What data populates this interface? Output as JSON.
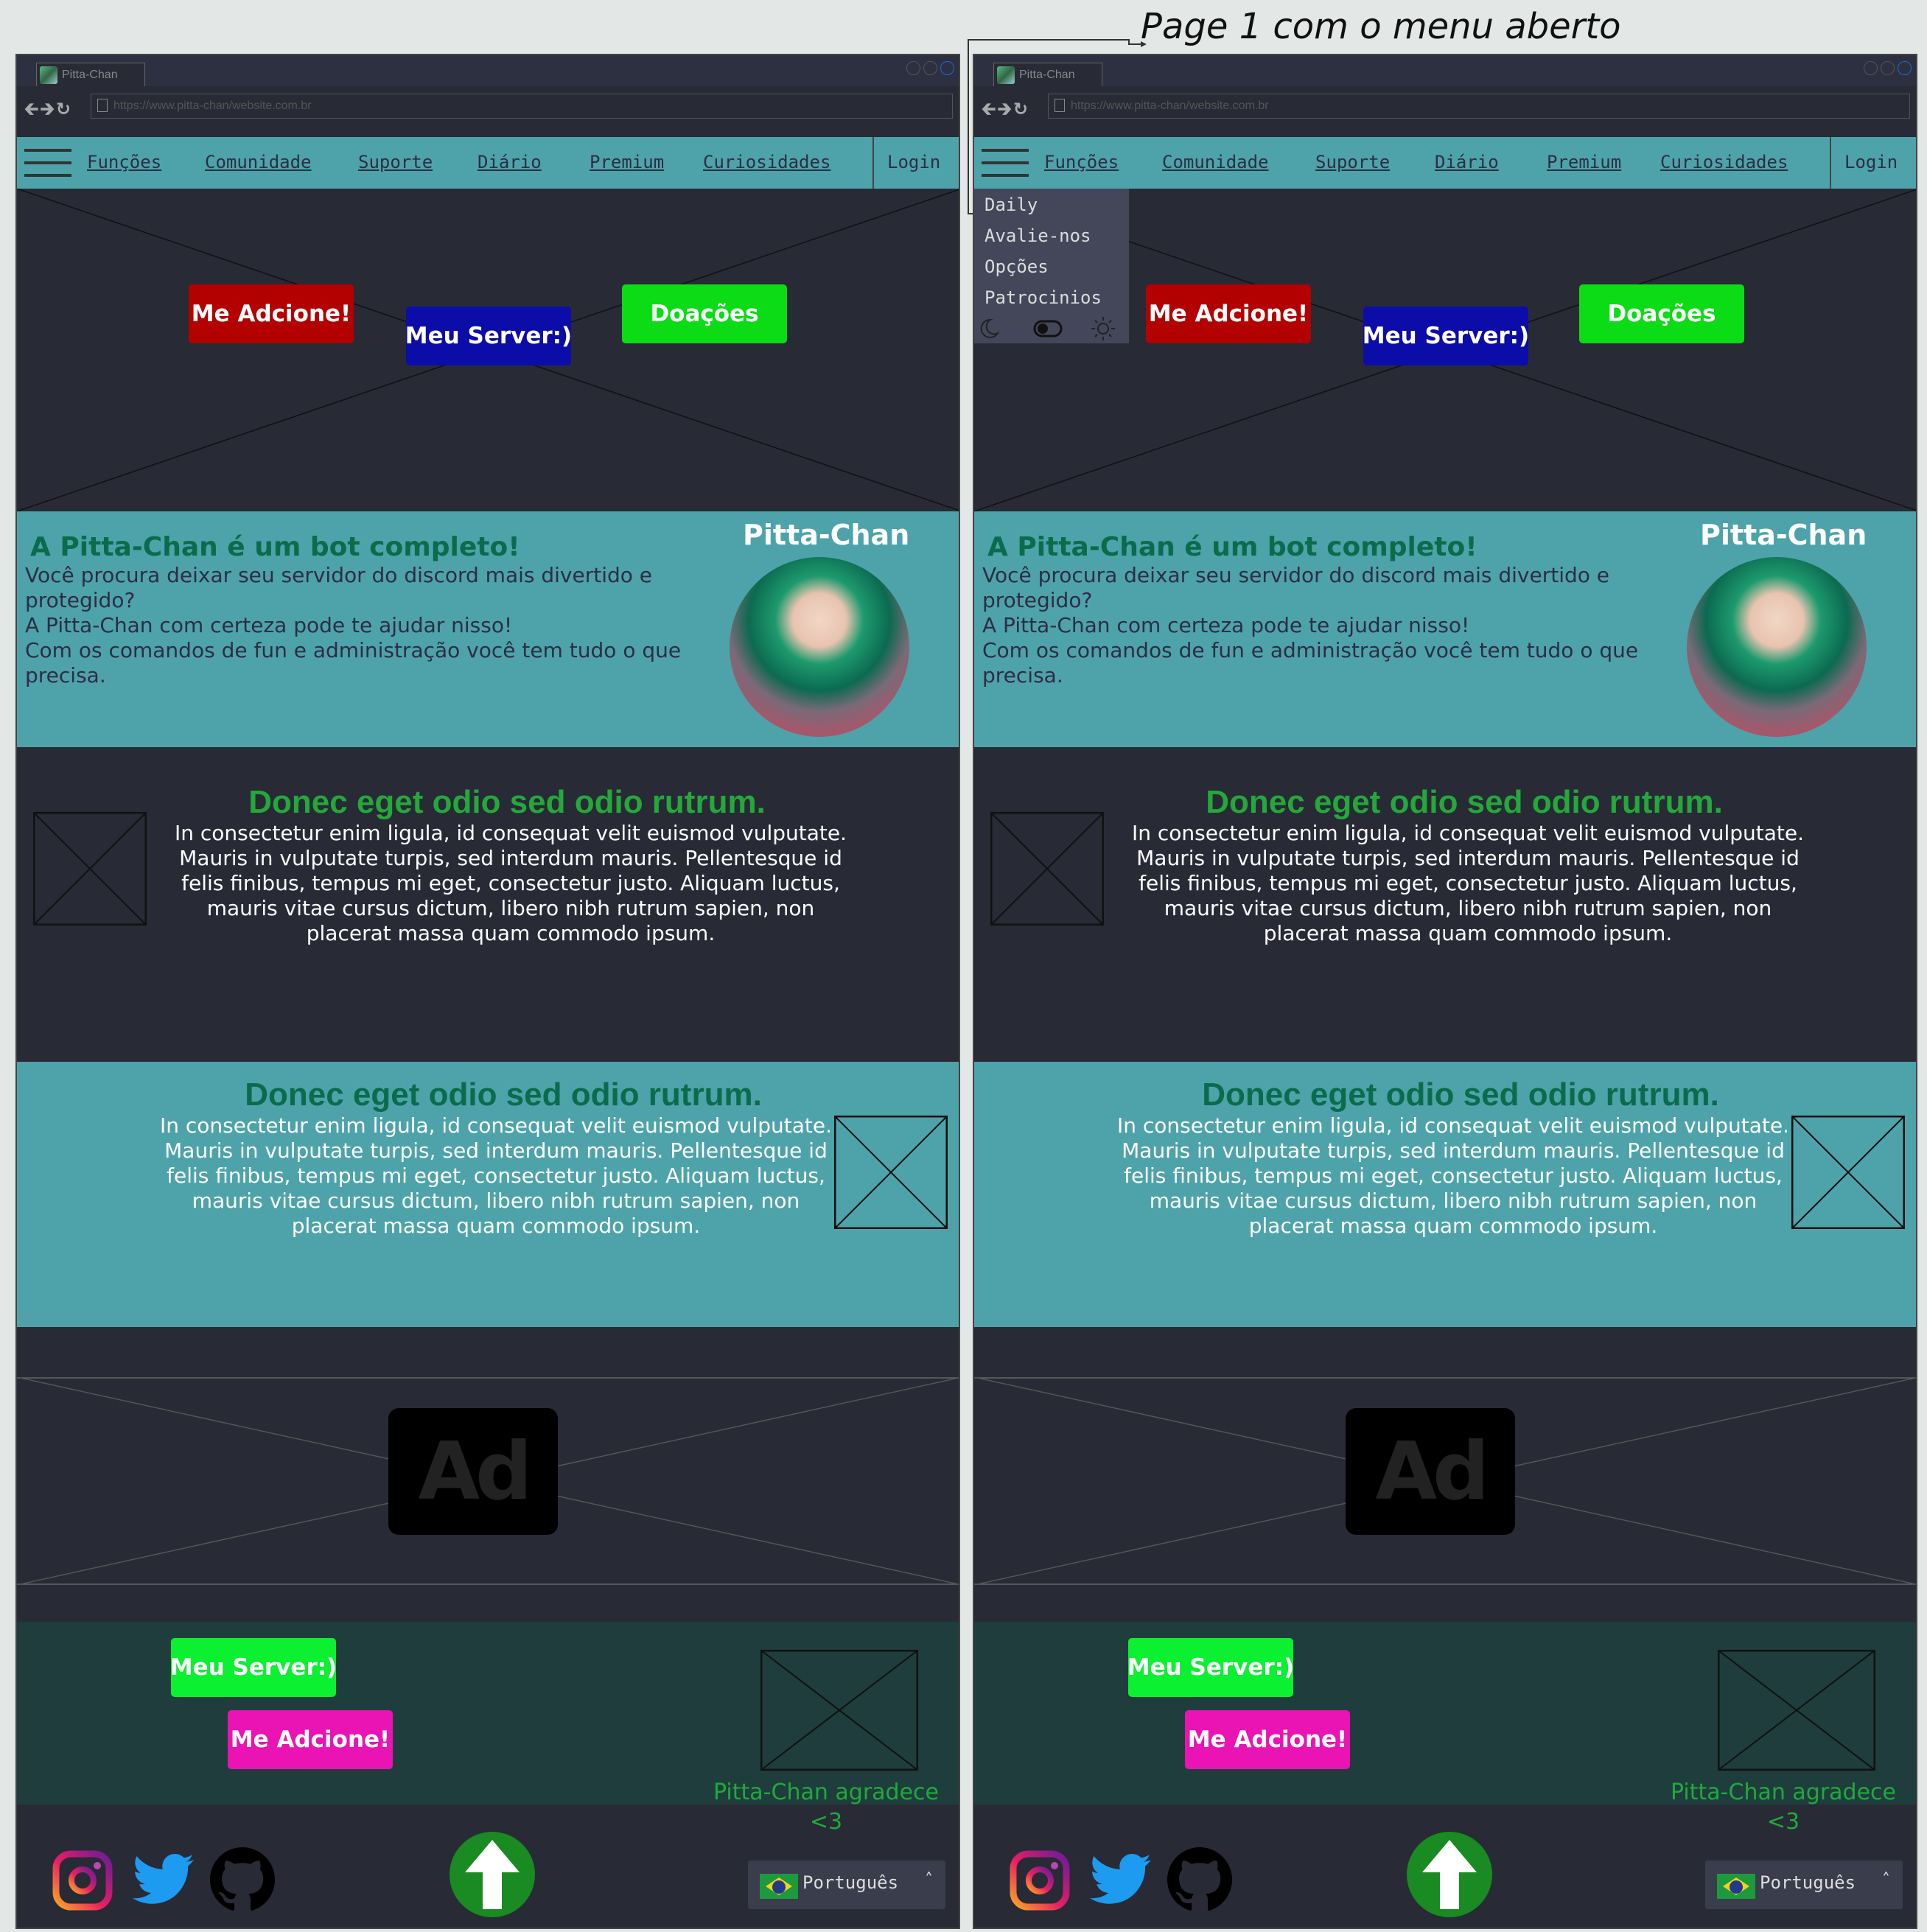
{
  "annotation": {
    "text": "Page 1 com o menu aberto"
  },
  "browser": {
    "tab_title": "Pitta-Chan",
    "url": "https://www.pitta-chan/website.com.br"
  },
  "nav": {
    "items": [
      "Funções",
      "Comunidade",
      "Suporte",
      "Diário",
      "Premium",
      "Curiosidades"
    ],
    "login": "Login"
  },
  "hero": {
    "add_label": "Me Adcione!",
    "server_label": "Meu Server:)",
    "donate_label": "Doações"
  },
  "about": {
    "title": "A Pitta-Chan é um bot completo!",
    "text": "Você procura deixar seu servidor do discord mais divertido e protegido?\nA Pitta-Chan com certeza pode te ajudar nisso!\nCom os comandos de fun e administração você tem tudo o que precisa.",
    "bot_name": "Pitta-Chan"
  },
  "section1": {
    "title": "Donec eget odio sed odio rutrum.",
    "text": "In consectetur enim ligula, id consequat velit euismod vulputate. Mauris in vulputate turpis, sed interdum mauris. Pellentesque id felis finibus, tempus mi eget, consectetur justo. Aliquam luctus, mauris vitae cursus dictum, libero nibh rutrum sapien, non placerat massa quam commodo ipsum."
  },
  "section2": {
    "title": "Donec eget odio sed odio rutrum.",
    "text": "In consectetur enim ligula, id consequat velit euismod vulputate. Mauris in vulputate turpis, sed interdum mauris. Pellentesque id felis finibus, tempus mi eget, consectetur justo. Aliquam luctus, mauris vitae cursus dictum, libero nibh rutrum sapien, non placerat massa quam commodo ipsum."
  },
  "ad": {
    "label": "Ad"
  },
  "footer": {
    "server_label": "Meu Server:)",
    "add_label": "Me Adcione!",
    "thanks_line1": "Pitta-Chan agradece",
    "thanks_line2": "<3",
    "language": "Português",
    "social_icons": [
      "instagram-icon",
      "twitter-icon",
      "github-icon"
    ]
  },
  "menu": {
    "items": [
      "Daily",
      "Avalie-nos",
      "Opções",
      "Patrocinios"
    ]
  },
  "colors": {
    "teal": "#4ea3aa",
    "dark": "#282a36",
    "footer": "#1f3d3d",
    "add_red": "#b30000",
    "server_blue": "#0c0ca8",
    "donate_green": "#0bdc16",
    "footer_green": "#0bf031",
    "footer_pink": "#e914b3",
    "title_green": "#24a83a",
    "title_dark_green": "#0b6b4b"
  }
}
